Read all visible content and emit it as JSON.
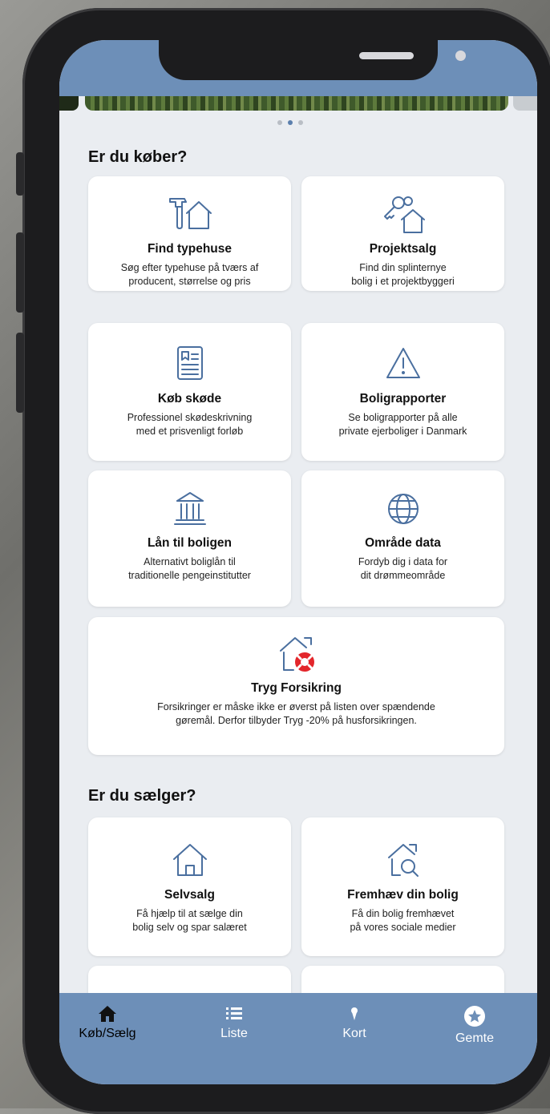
{
  "buyer_section": {
    "title": "Er du køber?",
    "cards": [
      {
        "icon": "tools-house-icon",
        "title": "Find typehuse",
        "desc": "Søg efter typehuse på tværs af\nproducent, størrelse og pris"
      },
      {
        "icon": "keys-house-icon",
        "title": "Projektsalg",
        "desc": "Find din splinternye\nbolig i et projektbyggeri"
      },
      {
        "icon": "document-icon",
        "title": "Køb skøde",
        "desc": "Professionel skødeskrivning\nmed et prisvenligt forløb"
      },
      {
        "icon": "warning-icon",
        "title": "Boligrapporter",
        "desc": "Se boligrapporter på alle\nprivate ejerboliger i Danmark"
      },
      {
        "icon": "bank-icon",
        "title": "Lån til boligen",
        "desc": "Alternativt boliglån til\ntraditionelle pengeinstitutter"
      },
      {
        "icon": "globe-icon",
        "title": "Område data",
        "desc": "Fordyb dig i data for\ndit drømmeområde"
      }
    ],
    "wide_card": {
      "icon": "house-lifebuoy-icon",
      "title": "Tryg Forsikring",
      "desc": "Forsikringer er måske ikke er øverst på listen over spændende\ngøremål. Derfor tilbyder Tryg -20% på husforsikringen."
    }
  },
  "seller_section": {
    "title": "Er du sælger?",
    "cards": [
      {
        "icon": "house-icon",
        "title": "Selvsalg",
        "desc": "Få hjælp til at sælge din\nbolig selv og spar salæret"
      },
      {
        "icon": "house-search-icon",
        "title": "Fremhæv din bolig",
        "desc": "Få din bolig fremhævet\npå vores sociale medier"
      }
    ]
  },
  "tabbar": {
    "tabs": [
      {
        "icon": "home-icon",
        "label": "Køb/Sælg",
        "active": true
      },
      {
        "icon": "list-icon",
        "label": "Liste",
        "active": false
      },
      {
        "icon": "map-pin-icon",
        "label": "Kort",
        "active": false
      },
      {
        "icon": "star-icon",
        "label": "Gemte",
        "active": false
      }
    ]
  },
  "colors": {
    "accent": "#6d8fb8",
    "icon_blue": "#4a6f9f",
    "tryg_red": "#e3262b",
    "background": "#eaedf1"
  }
}
